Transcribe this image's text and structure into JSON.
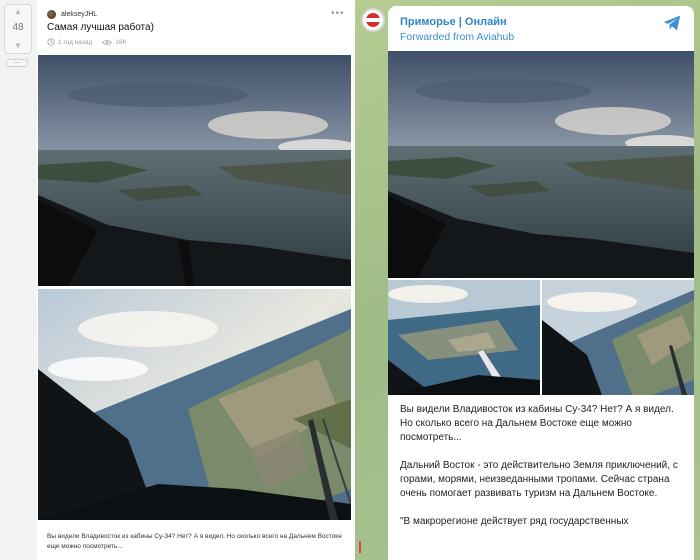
{
  "pikabu": {
    "rating": "48",
    "author": "alekseyJHL",
    "title": "Самая лучшая работа)",
    "time": "1 год назад",
    "views": "16K",
    "text": "Вы видели Владивосток из кабины Су-34? Нет? А я видел. Но сколько всего на Дальнем Востоке еще можно посмотреть..."
  },
  "telegram": {
    "channel": "Приморье | Онлайн",
    "forwarded": "Forwarded from Aviahub",
    "paragraphs": [
      "Вы видели Владивосток из кабины Су-34? Нет? А я видел. Но сколько всего на Дальнем Востоке еще можно посмотреть...",
      "Дальний Восток - это действительно Земля приключений, с горами, морями, неизведанными тропами. Сейчас страна очень помогает развивать туризм на Дальнем Востоке.",
      "\"В макрорегионе действует ряд государственных"
    ]
  },
  "icons": {
    "vote_up": "chevron-up-icon",
    "vote_down": "chevron-down-icon",
    "clock": "clock-icon",
    "views": "eye-icon",
    "more": "more-dots-icon",
    "telegram": "telegram-plane-icon"
  },
  "colors": {
    "link_blue": "#2f86c9",
    "telegram_bg": "#a9c28e"
  }
}
